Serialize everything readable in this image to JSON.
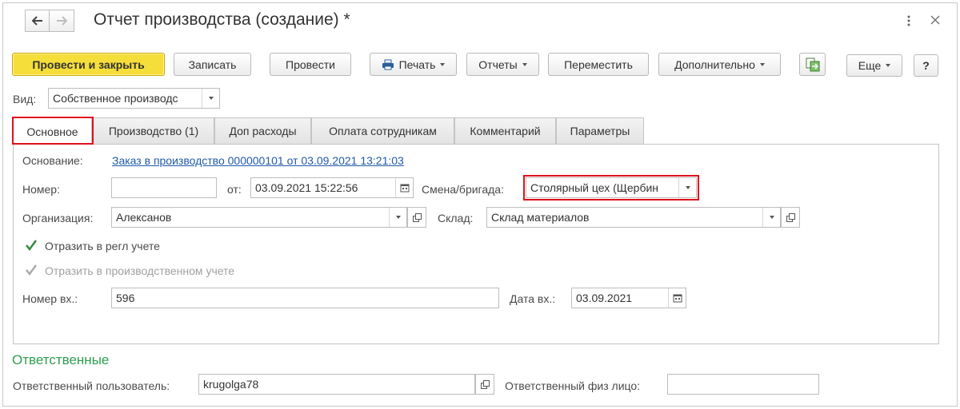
{
  "window": {
    "title": "Отчет производства (создание) *",
    "back_icon": "arrow-left-icon",
    "forward_icon": "arrow-right-icon",
    "menu_icon": "more-vertical-icon",
    "close_icon": "close-icon"
  },
  "toolbar": {
    "post_and_close": "Провести и закрыть",
    "save": "Записать",
    "post": "Провести",
    "print": "Печать",
    "reports": "Отчеты",
    "move": "Переместить",
    "additional": "Дополнительно",
    "more": "Еще",
    "help": "?"
  },
  "vid": {
    "label": "Вид:",
    "value": "Собственное производс"
  },
  "tabs": [
    {
      "label": "Основное"
    },
    {
      "label": "Производство (1)"
    },
    {
      "label": "Доп расходы"
    },
    {
      "label": "Оплата сотрудникам"
    },
    {
      "label": "Комментарий"
    },
    {
      "label": "Параметры"
    }
  ],
  "main": {
    "basis_label": "Основание:",
    "basis_link": "Заказ в производство 000000101 от 03.09.2021 13:21:03",
    "number_label": "Номер:",
    "number_value": "",
    "from_label": "от:",
    "date_value": "03.09.2021 15:22:56",
    "shift_label": "Смена/бригада:",
    "shift_value": "Столярный цех (Щербин",
    "org_label": "Организация:",
    "org_value": "Алексанов",
    "warehouse_label": "Склад:",
    "warehouse_value": "Склад материалов",
    "reg_accounting_label": "Отразить в регл учете",
    "prod_accounting_label": "Отразить в производственном учете",
    "incoming_number_label": "Номер вх.:",
    "incoming_number_value": "596",
    "incoming_date_label": "Дата вх.:",
    "incoming_date_value": "03.09.2021"
  },
  "responsible": {
    "section_title": "Ответственные",
    "user_label": "Ответственный пользователь:",
    "user_value": "krugolga78",
    "person_label": "Ответственный физ лицо:",
    "person_value": ""
  },
  "colors": {
    "primary_button": "#f6de3a",
    "link": "#1f5aa8",
    "section_title": "#2e9e4f",
    "highlight": "#e0101e",
    "checkbox": "#2e8b3a"
  }
}
